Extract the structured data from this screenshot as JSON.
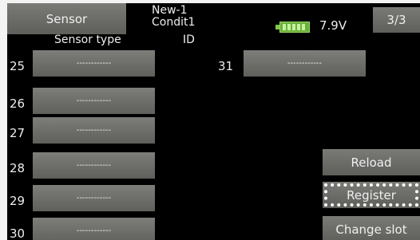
{
  "header": {
    "title_button": "Sensor",
    "model_name": "New-1",
    "condition": "Condit1",
    "battery_icon": "battery-full-icon",
    "voltage": "7.9V",
    "page_indicator": "3/3"
  },
  "columns": {
    "sensor_type": "Sensor type",
    "id": "ID"
  },
  "slots": [
    {
      "number": "25",
      "value": "------------"
    },
    {
      "number": "26",
      "value": "------------"
    },
    {
      "number": "27",
      "value": "------------"
    },
    {
      "number": "28",
      "value": "------------"
    },
    {
      "number": "29",
      "value": "------------"
    },
    {
      "number": "30",
      "value": "------------"
    },
    {
      "number": "31",
      "value": "------------"
    }
  ],
  "actions": {
    "reload": "Reload",
    "register": "Register",
    "change_slot": "Change slot"
  },
  "colors": {
    "screen_background": "#000000",
    "button_gray": "#6b6b68",
    "text": "#ededed",
    "battery_green": "#6ab03a"
  }
}
